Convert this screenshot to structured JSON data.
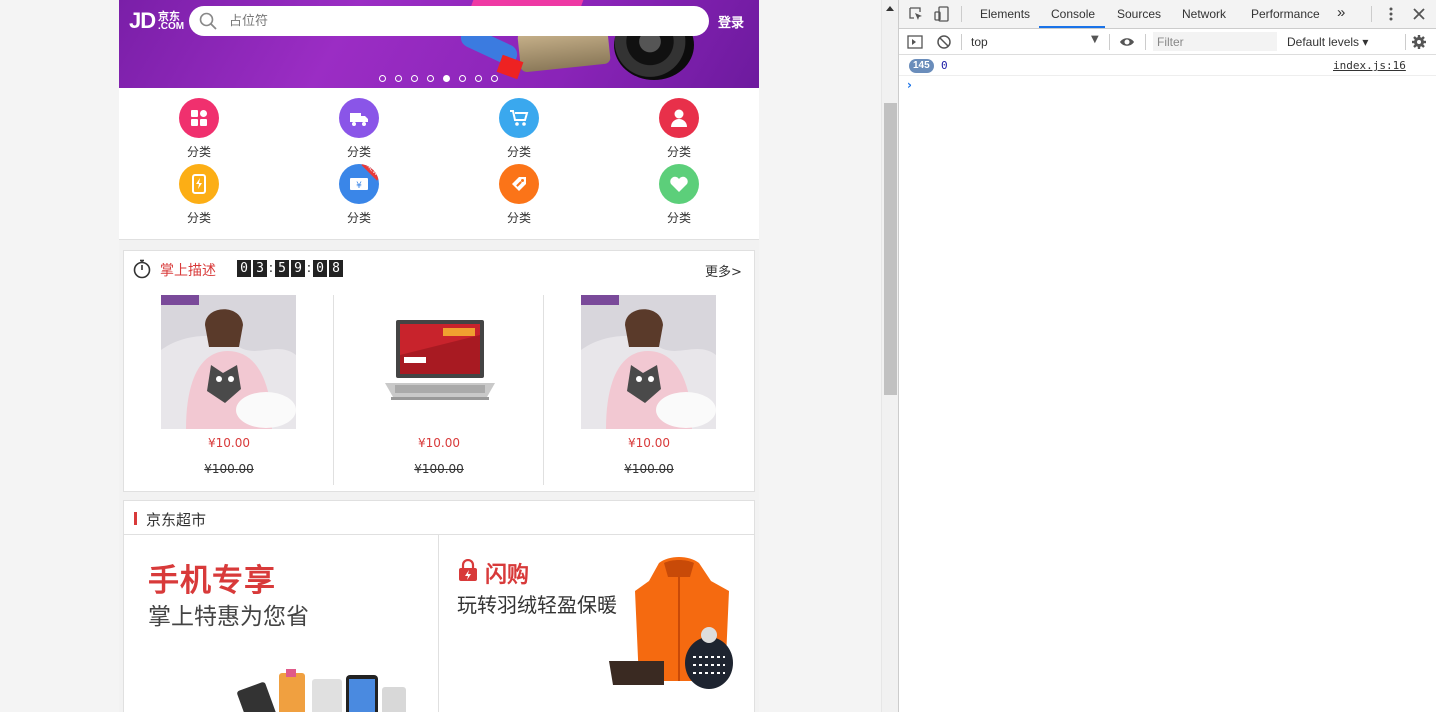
{
  "header": {
    "logo_jd": "JD",
    "logo_cn": "京东",
    "logo_com": ".COM",
    "search_placeholder": "占位符",
    "login_label": "登录"
  },
  "banner": {
    "slide_count": 8,
    "active_slide": 5
  },
  "nav": {
    "items": [
      {
        "label": "分类",
        "icon": "grid-icon",
        "color": "#f0306e"
      },
      {
        "label": "分类",
        "icon": "truck-icon",
        "color": "#8a55e8"
      },
      {
        "label": "分类",
        "icon": "cart-icon",
        "color": "#3aa8ee"
      },
      {
        "label": "分类",
        "icon": "user-icon",
        "color": "#e8304a"
      },
      {
        "label": "分类",
        "icon": "phone-charge-icon",
        "color": "#fcae15"
      },
      {
        "label": "分类",
        "icon": "ticket-icon",
        "color": "#3a86e8"
      },
      {
        "label": "分类",
        "icon": "coupon-icon",
        "color": "#fb7418"
      },
      {
        "label": "分类",
        "icon": "heart-icon",
        "color": "#5ccf7a"
      }
    ],
    "new_tag": "NEW"
  },
  "seckill": {
    "title": "掌上描述",
    "timer": [
      "0",
      "3",
      "5",
      "9",
      "0",
      "8"
    ],
    "more_label": "更多>",
    "products": [
      {
        "price": "¥10.00",
        "old_price": "¥100.00",
        "image": "pajamas-photo"
      },
      {
        "price": "¥10.00",
        "old_price": "¥100.00",
        "image": "laptop-photo"
      },
      {
        "price": "¥10.00",
        "old_price": "¥100.00",
        "image": "pajamas-photo"
      }
    ]
  },
  "market": {
    "title": "京东超市",
    "left": {
      "headline": "手机专享",
      "subline": "掌上特惠为您省"
    },
    "right": {
      "headline": "闪购",
      "subline": "玩转羽绒轻盈保暖"
    }
  },
  "devtools": {
    "tabs": [
      "Elements",
      "Console",
      "Sources",
      "Network",
      "Performance"
    ],
    "active_tab": "Console",
    "more_tabs": "»",
    "context": "top",
    "filter_placeholder": "Filter",
    "levels": "Default levels ▾",
    "message": {
      "count": "145",
      "value": "0",
      "source": "index.js:16"
    },
    "prompt": "›"
  }
}
